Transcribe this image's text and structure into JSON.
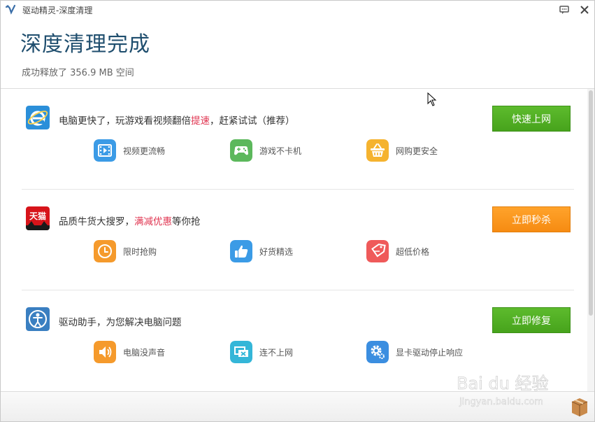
{
  "window": {
    "title": "驱动精灵-深度清理"
  },
  "header": {
    "title": "深度清理完成",
    "subtitle": "成功释放了 356.9 MB 空间"
  },
  "cards": [
    {
      "headline_before": "电脑更快了，玩游戏看视频翻倍",
      "headline_highlight": "提速",
      "headline_after": "，赶紧试试（推荐）",
      "button_label": "快速上网",
      "features": [
        "视频更流畅",
        "游戏不卡机",
        "网购更安全"
      ]
    },
    {
      "headline_before": "品质牛货大搜罗，",
      "headline_highlight": "满减优惠",
      "headline_after": "等你抢",
      "brand_text": "天猫",
      "button_label": "立即秒杀",
      "features": [
        "限时抢购",
        "好货精选",
        "超低价格"
      ]
    },
    {
      "headline_before": "驱动助手，为您解决电脑问题",
      "headline_highlight": "",
      "headline_after": "",
      "button_label": "立即修复",
      "features": [
        "电脑没声音",
        "连不上网",
        "显卡驱动停止响应"
      ]
    }
  ],
  "watermark": {
    "brand": "Bai du 经验",
    "url": "jingyan.baidu.com"
  },
  "colors": {
    "title": "#1f4e6e",
    "highlight": "#e0334f",
    "green_button": "#4fae22",
    "orange_button": "#f8961c"
  }
}
